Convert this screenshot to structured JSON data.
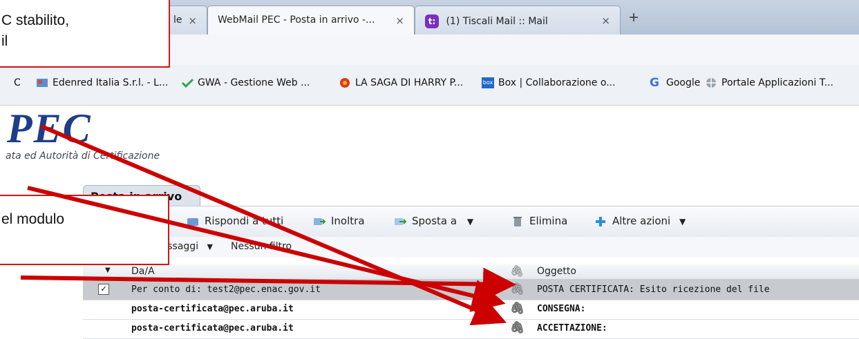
{
  "browser": {
    "tabs": [
      {
        "label": "le",
        "close": "×"
      },
      {
        "label": "WebMail PEC - Posta in arrivo -...",
        "close": "×"
      },
      {
        "label": "(1) Tiscali Mail :: Mail",
        "close": "×",
        "icon_text": "t:"
      }
    ],
    "new_tab": "+"
  },
  "bookmarks": [
    {
      "label": "C",
      "icon": "folder-icon"
    },
    {
      "label": "Edenred Italia S.r.l. - L...",
      "icon": "edenred-icon"
    },
    {
      "label": "GWA - Gestione Web ...",
      "icon": "gwa-check-icon"
    },
    {
      "label": "LA SAGA DI HARRY P...",
      "icon": "harry-potter-icon"
    },
    {
      "label": "Box | Collaborazione o...",
      "icon": "box-icon",
      "icon_text": "box"
    },
    {
      "label": "Google",
      "icon": "google-icon",
      "icon_text": "G"
    },
    {
      "label": "Portale Applicazioni T...",
      "icon": "globe-icon"
    }
  ],
  "app": {
    "logo_text": "PEC",
    "subtitle": "ata ed Autorità di Certificazione",
    "folder_tab": "Posta in arrivo"
  },
  "toolbar": {
    "reply_all": "Rispondi a tutti",
    "forward": "Inoltra",
    "move": "Sposta a",
    "delete": "Elimina",
    "more": "Altre azioni",
    "filter_messages": "messaggi",
    "filter_none": "Nessun filtro"
  },
  "grid": {
    "col_from": "Da/A",
    "col_subject": "Oggetto",
    "rows": [
      {
        "from": "Per conto di: test2@pec.enac.gov.it",
        "subject": "POSTA CERTIFICATA: Esito ricezione del file",
        "selected": true,
        "bold": false
      },
      {
        "from": "posta-certificata@pec.aruba.it",
        "subject": "CONSEGNA:",
        "selected": false,
        "bold": true
      },
      {
        "from": "posta-certificata@pec.aruba.it",
        "subject": "ACCETTAZIONE:",
        "selected": false,
        "bold": true
      }
    ]
  },
  "callouts": {
    "top_line1": "C stabilito,",
    "top_line2": "il",
    "middle": "el modulo"
  },
  "colors": {
    "accent_red": "#d01515",
    "logo_blue": "#1e3d8a",
    "selected_row": "#c3c7cc"
  }
}
